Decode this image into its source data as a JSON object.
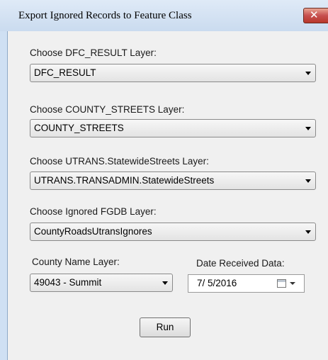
{
  "window": {
    "title": "Export Ignored Records to Feature Class",
    "close_glyph": "✕"
  },
  "fields": [
    {
      "label": "Choose DFC_RESULT Layer:",
      "value": "DFC_RESULT"
    },
    {
      "label": "Choose COUNTY_STREETS Layer:",
      "value": "COUNTY_STREETS"
    },
    {
      "label": "Choose UTRANS.StatewideStreets Layer:",
      "value": "UTRANS.TRANSADMIN.StatewideStreets"
    },
    {
      "label": "Choose Ignored FGDB Layer:",
      "value": "CountyRoadsUtransIgnores"
    }
  ],
  "county": {
    "label": "County Name Layer:",
    "value": "49043 - Summit"
  },
  "date": {
    "label": "Date Received Data:",
    "value": "7/ 5/2016"
  },
  "run_label": "Run",
  "icons": {
    "close": "close-icon",
    "calendar": "calendar-icon",
    "dropdown": "chevron-down-icon"
  }
}
